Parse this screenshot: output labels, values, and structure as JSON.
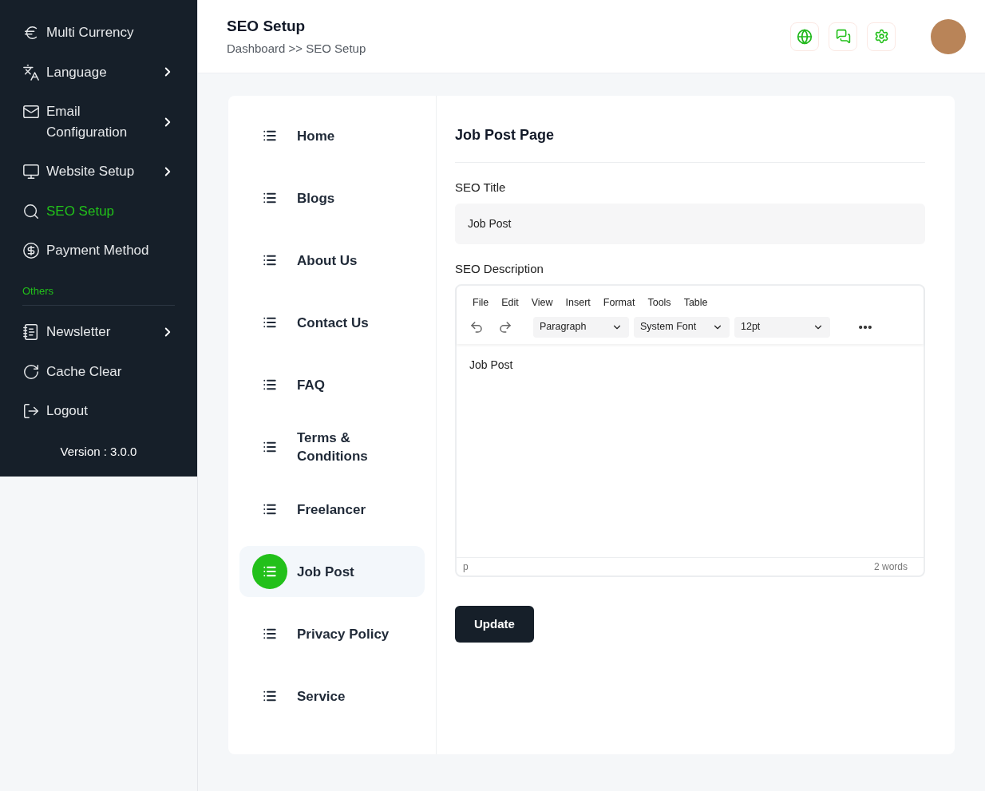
{
  "sidebar": {
    "items": [
      {
        "label": "Multi Currency",
        "expandable": false,
        "selected": false
      },
      {
        "label": "Language",
        "expandable": true,
        "selected": false
      },
      {
        "label": "Email Configuration",
        "expandable": true,
        "selected": false
      },
      {
        "label": "Website Setup",
        "expandable": true,
        "selected": false
      },
      {
        "label": "SEO Setup",
        "expandable": false,
        "selected": true
      },
      {
        "label": "Payment Method",
        "expandable": false,
        "selected": false
      }
    ],
    "section": "Others",
    "other_items": [
      {
        "label": "Newsletter",
        "expandable": true,
        "selected": false
      },
      {
        "label": "Cache Clear",
        "expandable": false,
        "selected": false
      },
      {
        "label": "Logout",
        "expandable": false,
        "selected": false
      }
    ],
    "version": "Version : 3.0.0"
  },
  "header": {
    "title": "SEO Setup",
    "breadcrumb": "Dashboard >> SEO Setup"
  },
  "pages": [
    {
      "label": "Home",
      "selected": false
    },
    {
      "label": "Blogs",
      "selected": false
    },
    {
      "label": "About Us",
      "selected": false
    },
    {
      "label": "Contact Us",
      "selected": false
    },
    {
      "label": "FAQ",
      "selected": false
    },
    {
      "label": "Terms & Conditions",
      "selected": false
    },
    {
      "label": "Freelancer",
      "selected": false
    },
    {
      "label": "Job Post",
      "selected": true
    },
    {
      "label": "Privacy Policy",
      "selected": false
    },
    {
      "label": "Service",
      "selected": false
    }
  ],
  "form": {
    "heading": "Job Post Page",
    "seo_title_label": "SEO Title",
    "seo_title_value": "Job Post",
    "seo_description_label": "SEO Description",
    "editor": {
      "menu": [
        "File",
        "Edit",
        "View",
        "Insert",
        "Format",
        "Tools",
        "Table"
      ],
      "block_format": "Paragraph",
      "font": "System Font",
      "size": "12pt",
      "content": "Job Post",
      "path": "p",
      "word_count": "2 words"
    },
    "submit": "Update"
  }
}
